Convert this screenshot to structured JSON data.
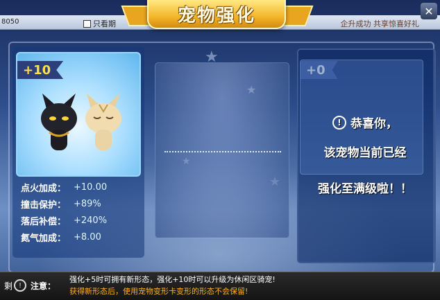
{
  "window": {
    "top_number": "8050",
    "checkbox_label": "只看期",
    "top_right_text": "企升成功 共享惊喜好礼",
    "close_icon": "close-icon"
  },
  "title": "宠物强化",
  "left_pet": {
    "level": "+10",
    "stats": [
      {
        "label": "点火加成：",
        "value": "+10.00"
      },
      {
        "label": "撞击保护：",
        "value": "+89%"
      },
      {
        "label": "落后补偿：",
        "value": "+240%"
      },
      {
        "label": "氮气加成：",
        "value": "+8.00"
      }
    ]
  },
  "right_pet": {
    "level": "+0",
    "message_lines": [
      "恭喜你，",
      "该宠物当前已经",
      "强化至满级啦！！"
    ]
  },
  "note": {
    "prefix": "剩",
    "label": "注意：",
    "line1": "强化+5时可拥有新形态，强化+10时可以升级为休闲区骑宠!",
    "line2": "获得新形态后，使用宠物变形卡变形的形态不会保留!"
  },
  "colors": {
    "level_gold": "#ffe04a",
    "note_orange": "#ffb020"
  }
}
